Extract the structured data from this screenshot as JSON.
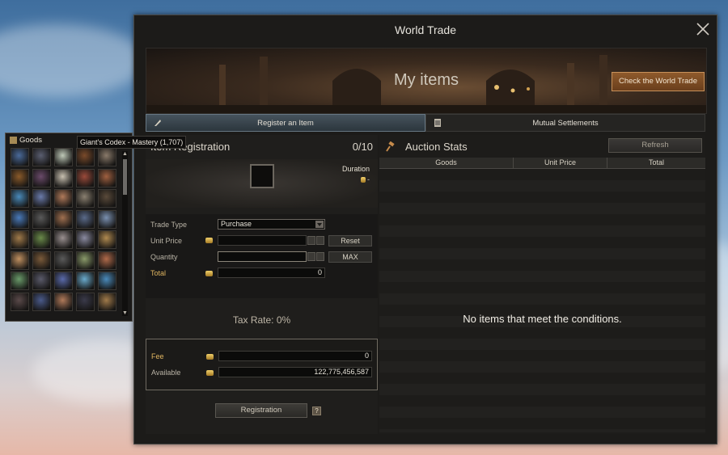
{
  "window": {
    "title": "World Trade"
  },
  "banner": {
    "title": "My items",
    "check_button": "Check the World Trade"
  },
  "tabs": [
    {
      "label": "Register an Item",
      "active": true
    },
    {
      "label": "Mutual Settlements",
      "active": false
    }
  ],
  "registration": {
    "title": "Item Registration",
    "count": "0/10",
    "duration_label": "Duration",
    "duration_value": "-",
    "trade_type_label": "Trade Type",
    "trade_type_value": "Purchase",
    "unit_price_label": "Unit Price",
    "unit_price_value": "",
    "reset_label": "Reset",
    "quantity_label": "Quantity",
    "quantity_value": "",
    "max_label": "MAX",
    "total_label": "Total",
    "total_value": "0",
    "tax_rate": "Tax Rate: 0%",
    "fee_label": "Fee",
    "fee_value": "0",
    "available_label": "Available",
    "available_value": "122,775,456,587",
    "register_button": "Registration",
    "help_label": "?"
  },
  "auction": {
    "title": "Auction Stats",
    "refresh": "Refresh",
    "columns": [
      "Goods",
      "Unit Price",
      "Total"
    ],
    "empty_message": "No items that meet the conditions."
  },
  "goods_window": {
    "title": "Goods",
    "tooltip": "Giant's Codex - Mastery (1,707)",
    "item_colors": [
      "#4a6a9a",
      "#5a5e70",
      "#bfc9b8",
      "#7a4a2a",
      "#8a7a6a",
      "#8a5a2a",
      "#6a4a6a",
      "#c8c0b0",
      "#9a4a3a",
      "#a06040",
      "#4a8aba",
      "#6a7aaa",
      "#b07a5a",
      "#8a8070",
      "#5a4a3a",
      "#4a7aba",
      "#5a5a5a",
      "#a07050",
      "#5a6a8a",
      "#7a90b0",
      "#a07a4a",
      "#6a8a4a",
      "#9a9090",
      "#8a8aa0",
      "#b08a50",
      "#c09060",
      "#7a5a3a",
      "#5a5a5a",
      "#8a9a6a",
      "#b06a4a",
      "#6a9a6a",
      "#5a5a6a",
      "#5a6aaa",
      "#6aaacc",
      "#4a8aba",
      "#5a4a4a",
      "#4a5a8a",
      "#b07a5a",
      "#3a3a4a",
      "#a07a4a"
    ]
  }
}
